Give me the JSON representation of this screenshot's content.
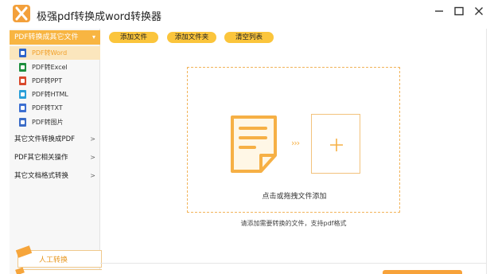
{
  "app": {
    "title": "极强pdf转换成word转换器",
    "logo_icon": "logo-x-icon",
    "accent_color": "#f8b542"
  },
  "window_controls": [
    "minimize-icon",
    "maximize-icon",
    "close-icon"
  ],
  "sidebar": {
    "group_header": "PDF转换成其它文件",
    "sub_items": [
      {
        "label": "PDF转Word",
        "icon": "word-file-icon",
        "color": "#2b63c9",
        "active": true
      },
      {
        "label": "PDF转Excel",
        "icon": "excel-file-icon",
        "color": "#1e8f3f",
        "active": false
      },
      {
        "label": "PDF转PPT",
        "icon": "ppt-file-icon",
        "color": "#d9482b",
        "active": false
      },
      {
        "label": "PDF转HTML",
        "icon": "html-file-icon",
        "color": "#2a9fd8",
        "active": false
      },
      {
        "label": "PDF转TXT",
        "icon": "txt-file-icon",
        "color": "#3d6fd1",
        "active": false
      },
      {
        "label": "PDF转图片",
        "icon": "image-file-icon",
        "color": "#3b6cc7",
        "active": false
      }
    ],
    "nav_items": [
      {
        "label": "其它文件转换成PDF",
        "chevron": ">"
      },
      {
        "label": "PDF其它相关操作",
        "chevron": ">"
      },
      {
        "label": "其它文档格式转换",
        "chevron": ">"
      }
    ],
    "promo_label": "人工转换"
  },
  "toolbar": {
    "add_file": "添加文件",
    "add_folder": "添加文件夹",
    "clear_list": "清空列表"
  },
  "dropzone": {
    "arrows": "›››",
    "text": "点击或拖拽文件添加",
    "hint": "请添加需要转换的文件，支持pdf格式"
  }
}
